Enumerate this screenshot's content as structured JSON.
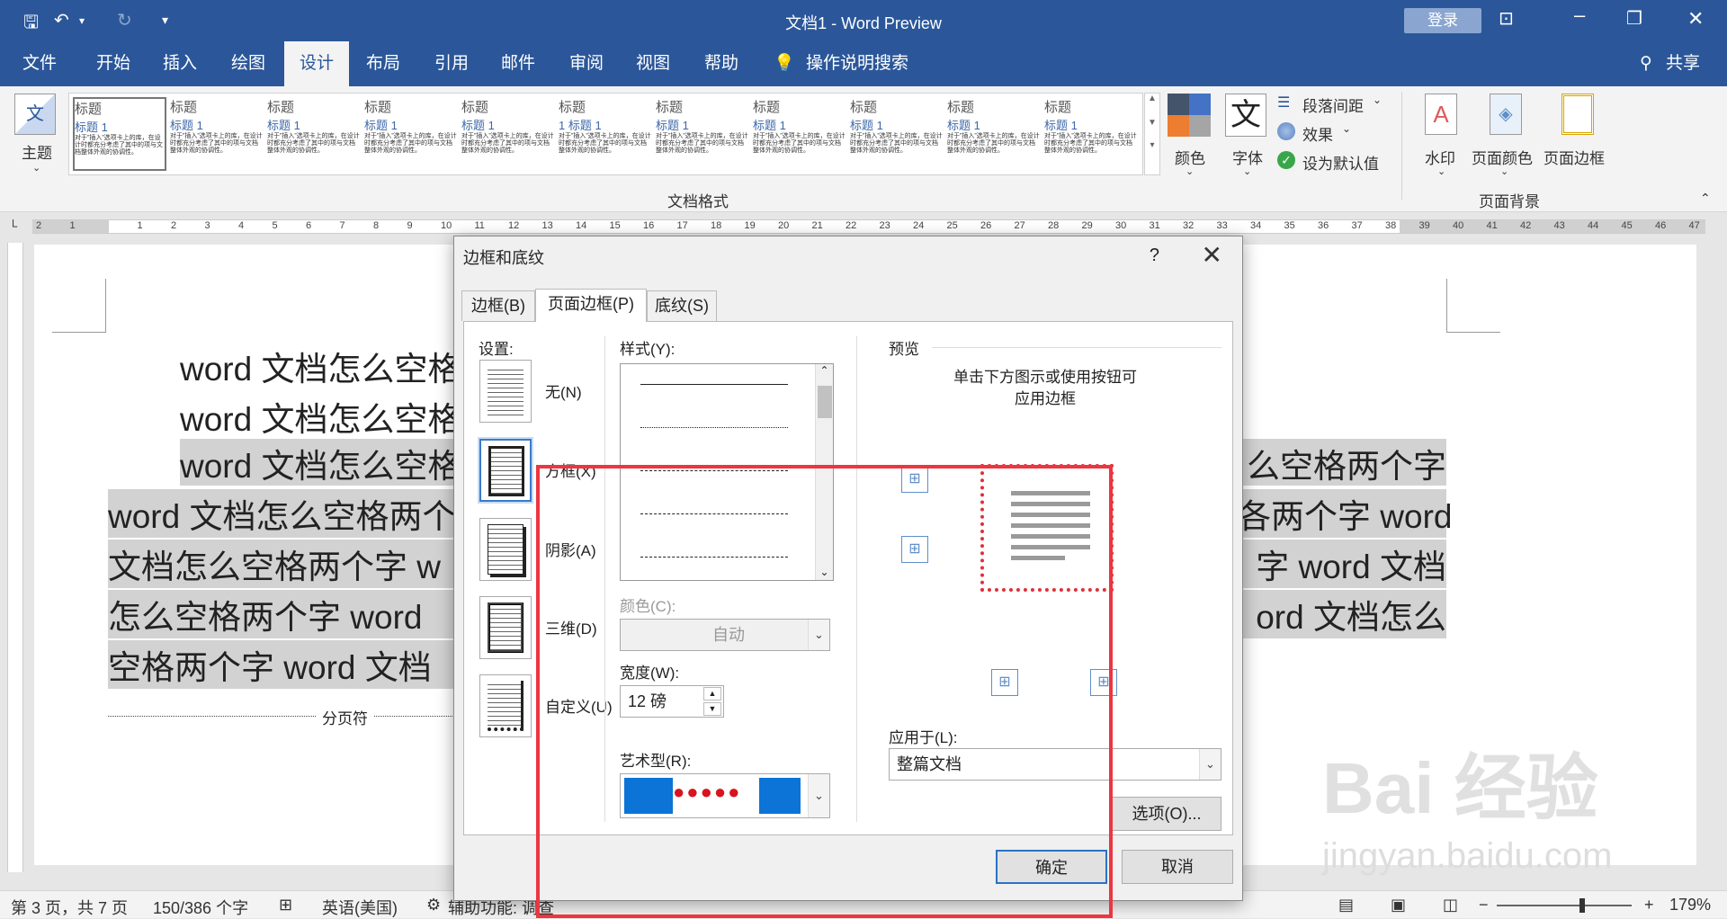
{
  "titlebar": {
    "doc": "文档1",
    "sep": " - ",
    "app": "Word Preview",
    "login": "登录",
    "qa_more": "⇥"
  },
  "tabs": [
    "文件",
    "开始",
    "插入",
    "绘图",
    "设计",
    "布局",
    "引用",
    "邮件",
    "审阅",
    "视图",
    "帮助",
    "操作说明搜索",
    "共享"
  ],
  "ribbon": {
    "theme": "主题",
    "gallery_items": [
      {
        "title": "标题",
        "h1": "标题 1",
        "body": "对于”插入”选项卡上的库，在设计时都充分考虑了其中的项与文档整体外观的协调性。"
      },
      {
        "title": "标题",
        "h1": "标题 1",
        "body": "对于”插入”选项卡上的库，在设计时都充分考虑了其中的项与文档整体外观的协调性。"
      },
      {
        "title": "标题",
        "h1": "标题 1",
        "body": "对于”插入”选项卡上的库，在设计时都充分考虑了其中的项与文档整体外观的协调性。"
      },
      {
        "title": "标题",
        "h1": "标题 1",
        "body": "对于”插入”选项卡上的库，在设计时都充分考虑了其中的项与文档整体外观的协调性。"
      },
      {
        "title": "标题",
        "h1": "标题 1",
        "body": "对于”插入”选项卡上的库，在设计时都充分考虑了其中的项与文档整体外观的协调性。"
      },
      {
        "title": "标题",
        "h1": "1 标题 1",
        "body": "对于”插入”选项卡上的库，在设计时都充分考虑了其中的项与文档整体外观的协调性。"
      },
      {
        "title": "标题",
        "h1": "标题 1",
        "body": "对于”插入”选项卡上的库，在设计时都充分考虑了其中的项与文档整体外观的协调性。"
      },
      {
        "title": "标题",
        "h1": "标题 1",
        "body": "对于”插入”选项卡上的库，在设计时都充分考虑了其中的项与文档整体外观的协调性。"
      },
      {
        "title": "标题",
        "h1": "标题 1",
        "body": "对于”插入”选项卡上的库，在设计时都充分考虑了其中的项与文档整体外观的协调性。"
      },
      {
        "title": "标题",
        "h1": "标题 1",
        "body": "对于”插入”选项卡上的库，在设计时都充分考虑了其中的项与文档整体外观的协调性。"
      },
      {
        "title": "标题",
        "h1": "标题 1",
        "body": "对于”插入”选项卡上的库，在设计时都充分考虑了其中的项与文档整体外观的协调性。"
      }
    ],
    "colors": "颜色",
    "fonts": "字体",
    "font_glyph": "文",
    "para_spacing": "段落间距",
    "effects": "效果",
    "set_default": "设为默认值",
    "group_doc_format": "文档格式",
    "watermark": "水印",
    "page_color": "页面颜色",
    "page_border": "页面边框",
    "group_page_bg": "页面背景"
  },
  "ruler": {
    "numbers": [
      "2",
      "1",
      "",
      "1",
      "2",
      "3",
      "4",
      "5",
      "6",
      "7",
      "8",
      "9",
      "10",
      "11",
      "12",
      "13",
      "14",
      "15",
      "16",
      "17",
      "18",
      "19",
      "20",
      "21",
      "22",
      "23",
      "24",
      "25",
      "26",
      "27",
      "28",
      "29",
      "30",
      "31",
      "32",
      "33",
      "34",
      "35",
      "36",
      "37",
      "38",
      "39",
      "40",
      "41",
      "42",
      "43",
      "44",
      "45",
      "46",
      "47"
    ]
  },
  "document": {
    "line1": "word 文档怎么空格",
    "line2": "word 文档怎么空格",
    "line3a": "word  文档怎么空格",
    "line3b": "么空格两个字",
    "line4a": "word 文档怎么空格两个",
    "line4b": "各两个字 word",
    "line5a": "文档怎么空格两个字 w",
    "line5b": "字 word 文档",
    "line6a": "怎么空格两个字 word",
    "line6b": "ord 文档怎么",
    "line7a": "空格两个字 word 文档",
    "pagebreak": "分页符"
  },
  "status": {
    "page": "第 3 页，共 7 页",
    "words": "150/386 个字",
    "lang": "英语(美国)",
    "access": "辅助功能: 调查",
    "zoom": "179%",
    "zoom_minus": "−",
    "zoom_plus": "+"
  },
  "dialog": {
    "title": "边框和底纹",
    "help": "?",
    "close": "✕",
    "tabs": [
      "边框(B)",
      "页面边框(P)",
      "底纹(S)"
    ],
    "setting_label": "设置:",
    "settings": [
      "无(N)",
      "方框(X)",
      "阴影(A)",
      "三维(D)",
      "自定义(U)"
    ],
    "style_label": "样式(Y):",
    "color_label": "颜色(C):",
    "color_value": "自动",
    "width_label": "宽度(W):",
    "width_value": "12 磅",
    "art_label": "艺术型(R):",
    "preview_label": "预览",
    "preview_hint": "单击下方图示或使用按钮可应用边框",
    "apply_label": "应用于(L):",
    "apply_value": "整篇文档",
    "options": "选项(O)...",
    "ok": "确定",
    "cancel": "取消"
  },
  "colors": {
    "accent": "#2b579a",
    "highlight": "#d2d2d2",
    "annotation": "#ec3640"
  }
}
